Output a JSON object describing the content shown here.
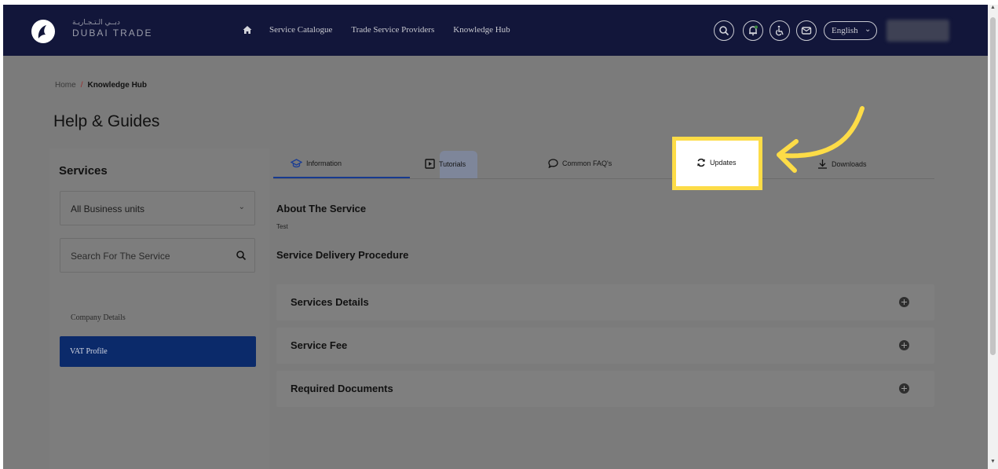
{
  "header": {
    "logo_arabic": "دبــي الـتـجـاريـة",
    "logo_english": "DUBAI TRADE",
    "nav": [
      "Service Catalogue",
      "Trade Service Providers",
      "Knowledge Hub"
    ],
    "language": "English",
    "icons": [
      "home-icon",
      "search-icon",
      "bell-icon",
      "accessibility-icon",
      "mail-icon"
    ]
  },
  "breadcrumb": {
    "home": "Home",
    "separator": "/",
    "current": "Knowledge Hub"
  },
  "page_title": "Help & Guides",
  "sidebar": {
    "heading": "Services",
    "business_unit": "All Business units",
    "search_placeholder": "Search For The Service",
    "items": [
      {
        "label": "Company Details",
        "active": false
      },
      {
        "label": "VAT Profile",
        "active": true
      }
    ]
  },
  "tabs": [
    {
      "label": "Information",
      "icon": "graduation-cap-icon",
      "active": true
    },
    {
      "label": "Tutorials",
      "icon": "play-box-icon",
      "active": false
    },
    {
      "label": "Common FAQ's",
      "icon": "chat-bubble-icon",
      "active": false
    },
    {
      "label": "Updates",
      "icon": "refresh-icon",
      "active": false,
      "highlighted": true
    },
    {
      "label": "Downloads",
      "icon": "download-icon",
      "active": false
    }
  ],
  "content": {
    "about_heading": "About The Service",
    "about_text": "Test",
    "procedure_heading": "Service Delivery Procedure",
    "accordions": [
      "Services Details",
      "Service Fee",
      "Required Documents"
    ]
  },
  "colors": {
    "topbar": "#12163a",
    "overlay": "#7b7b7b",
    "active_sidebar": "#0b2a6a",
    "highlight": "#fddc47",
    "breadcrumb_separator": "#9a2a2a"
  }
}
